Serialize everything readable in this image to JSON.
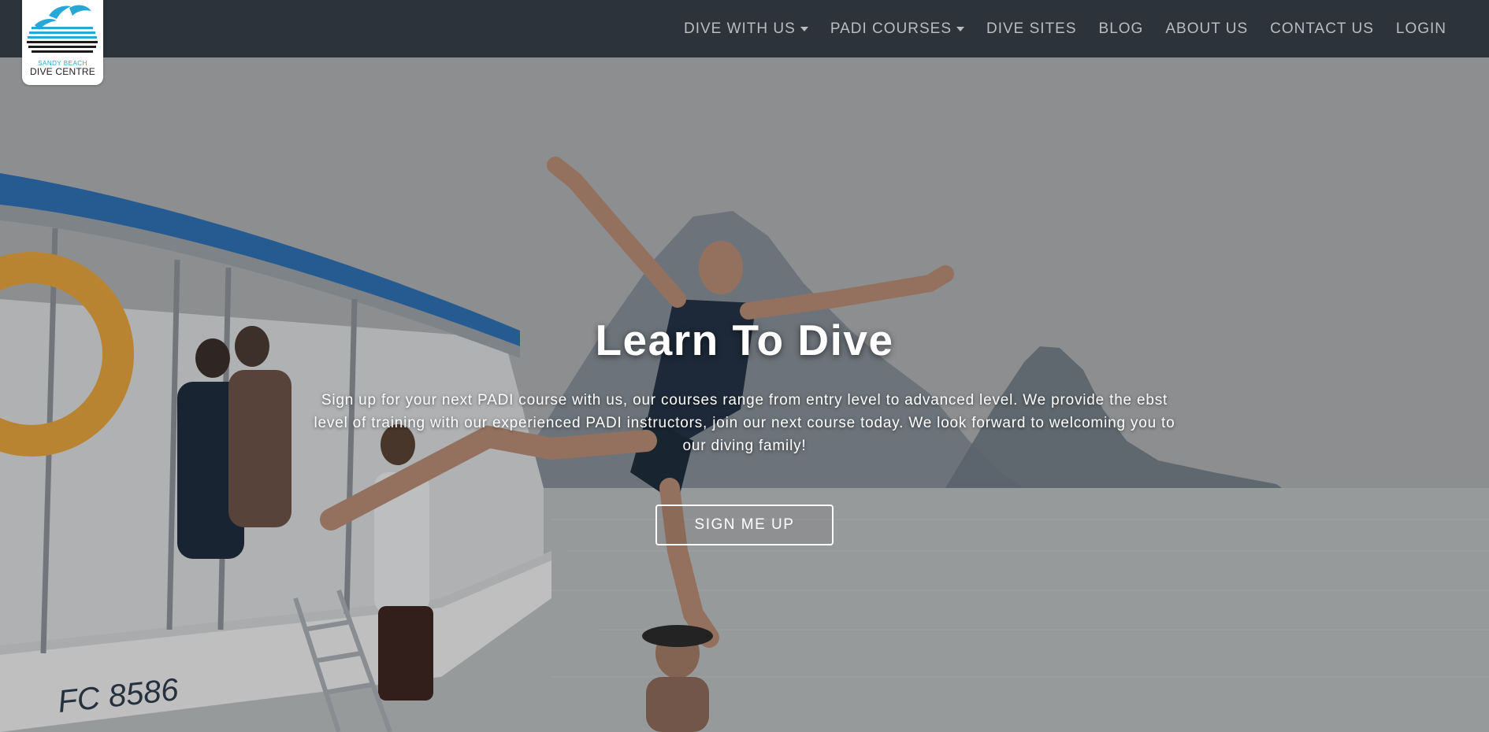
{
  "brand": {
    "logo_top": "SANDY BEACH",
    "logo_bottom": "DIVE CENTRE"
  },
  "nav": {
    "items": [
      {
        "label": "DIVE WITH US",
        "dropdown": true
      },
      {
        "label": "PADI COURSES",
        "dropdown": true
      },
      {
        "label": "DIVE SITES",
        "dropdown": false
      },
      {
        "label": "BLOG",
        "dropdown": false
      },
      {
        "label": "ABOUT US",
        "dropdown": false
      },
      {
        "label": "CONTACT US",
        "dropdown": false
      },
      {
        "label": "LOGIN",
        "dropdown": false
      }
    ]
  },
  "hero": {
    "title": "Learn To Dive",
    "text": "Sign up for your next PADI course with us, our courses range from entry level to advanced level. We provide the ebst level of training with our experienced PADI instructors, join our next course today. We look forward to welcoming you to our diving family!",
    "cta_label": "SIGN ME UP",
    "boat_text": "FC 8586"
  },
  "colors": {
    "navbar": "#2d333b",
    "nav_text": "#b9bdc1",
    "accent": "#27a7d6",
    "canopy": "#2f6fb3",
    "life_ring": "#e2a23c"
  }
}
